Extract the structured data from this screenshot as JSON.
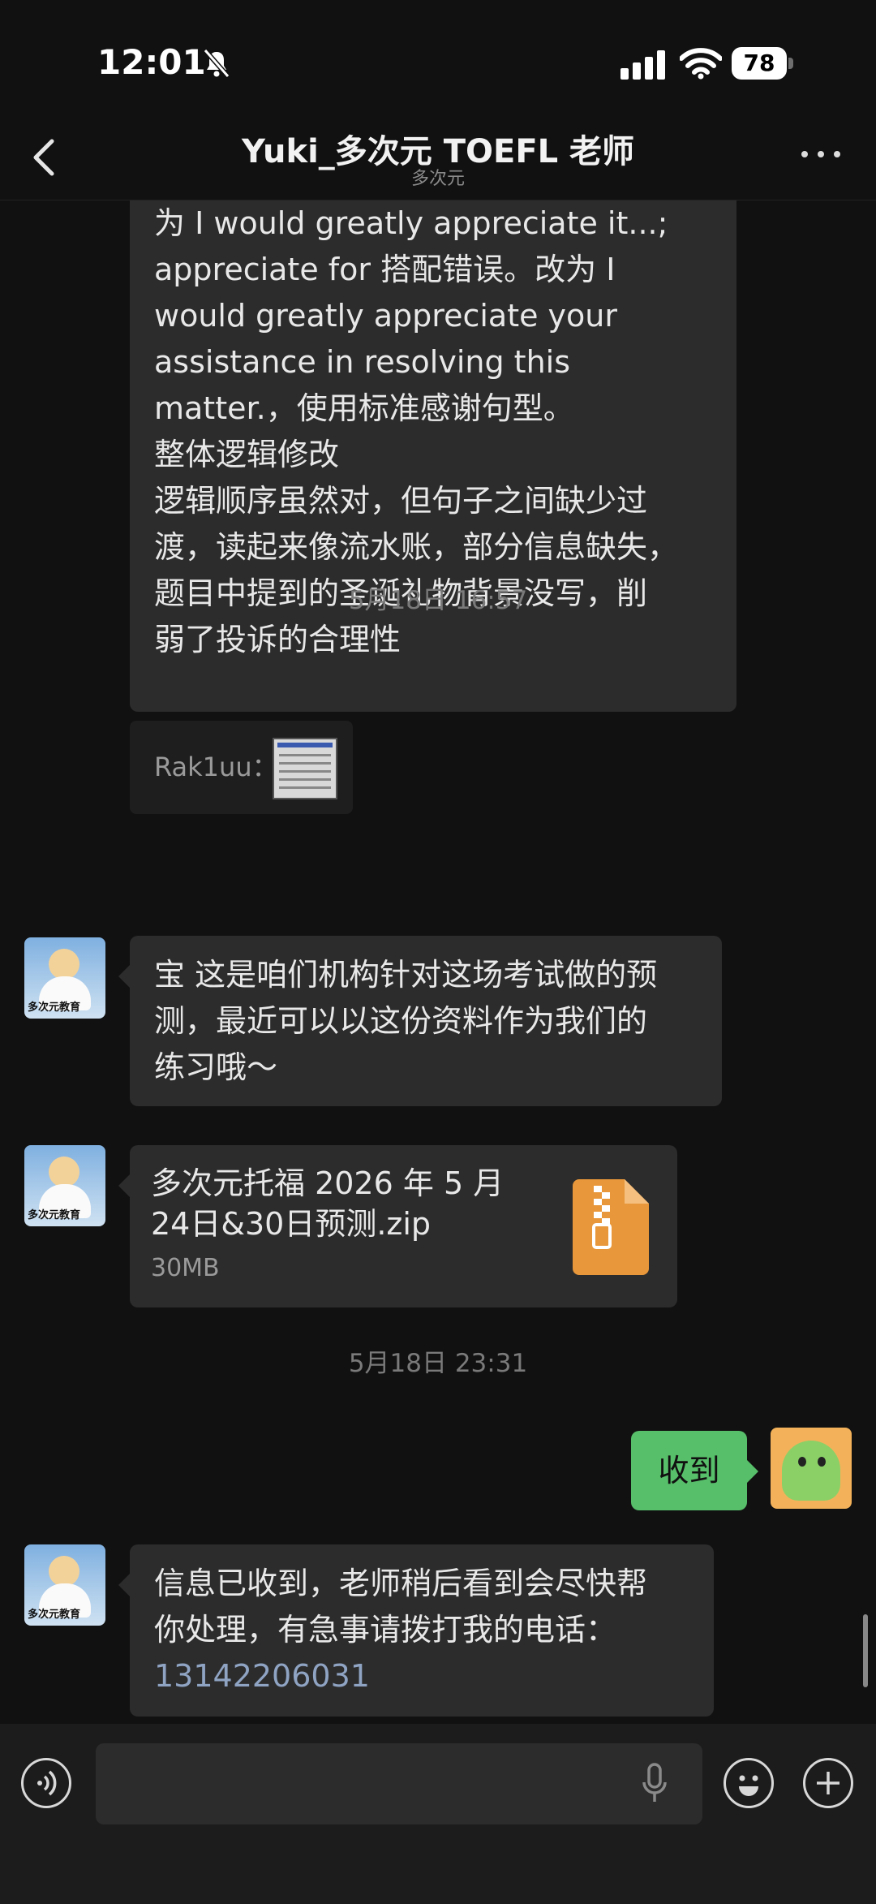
{
  "status_bar": {
    "time": "12:01",
    "battery": "78"
  },
  "header": {
    "title": "Yuki_多次元 TOEFL 老师",
    "subtitle": "多次元"
  },
  "messages": {
    "first_lines": [
      "为 I would greatly appreciate it...;",
      "appreciate for 搭配错误。改为 I",
      "would greatly appreciate your",
      "assistance in resolving this",
      "matter.，使用标准感谢句型。",
      "",
      "整体逻辑修改",
      "逻辑顺序虽然对，但句子之间缺少过",
      "渡，读起来像流水账，部分信息缺失，",
      "题目中提到的圣诞礼物背景没写，削",
      "弱了投诉的合理性"
    ],
    "quote_label": "Rak1uu：",
    "timestamp1": "5月18日 16:57",
    "second_lines": [
      "宝 这是咱们机构针对这场考试做的预",
      "测，最近可以以这份资料作为我们的",
      "练习哦～"
    ],
    "file": {
      "name_line1": "多次元托福 2026 年 5 月",
      "name_line2": "24日&30日预测.zip",
      "size": "30MB"
    },
    "timestamp2": "5月18日 23:31",
    "sent_text": "收到",
    "last_line1": "信息已收到，老师稍后看到会尽快帮",
    "last_line2": "你处理，有急事请拨打我的电话：",
    "phone": "13142206031"
  },
  "avatar_caption": "多次元教育",
  "input": {
    "placeholder": ""
  },
  "colors": {
    "background": "#111111",
    "bubble": "#2c2c2c",
    "sent_bubble": "#57be6a",
    "link": "#8fa3c2",
    "zip_icon": "#e8973a"
  }
}
